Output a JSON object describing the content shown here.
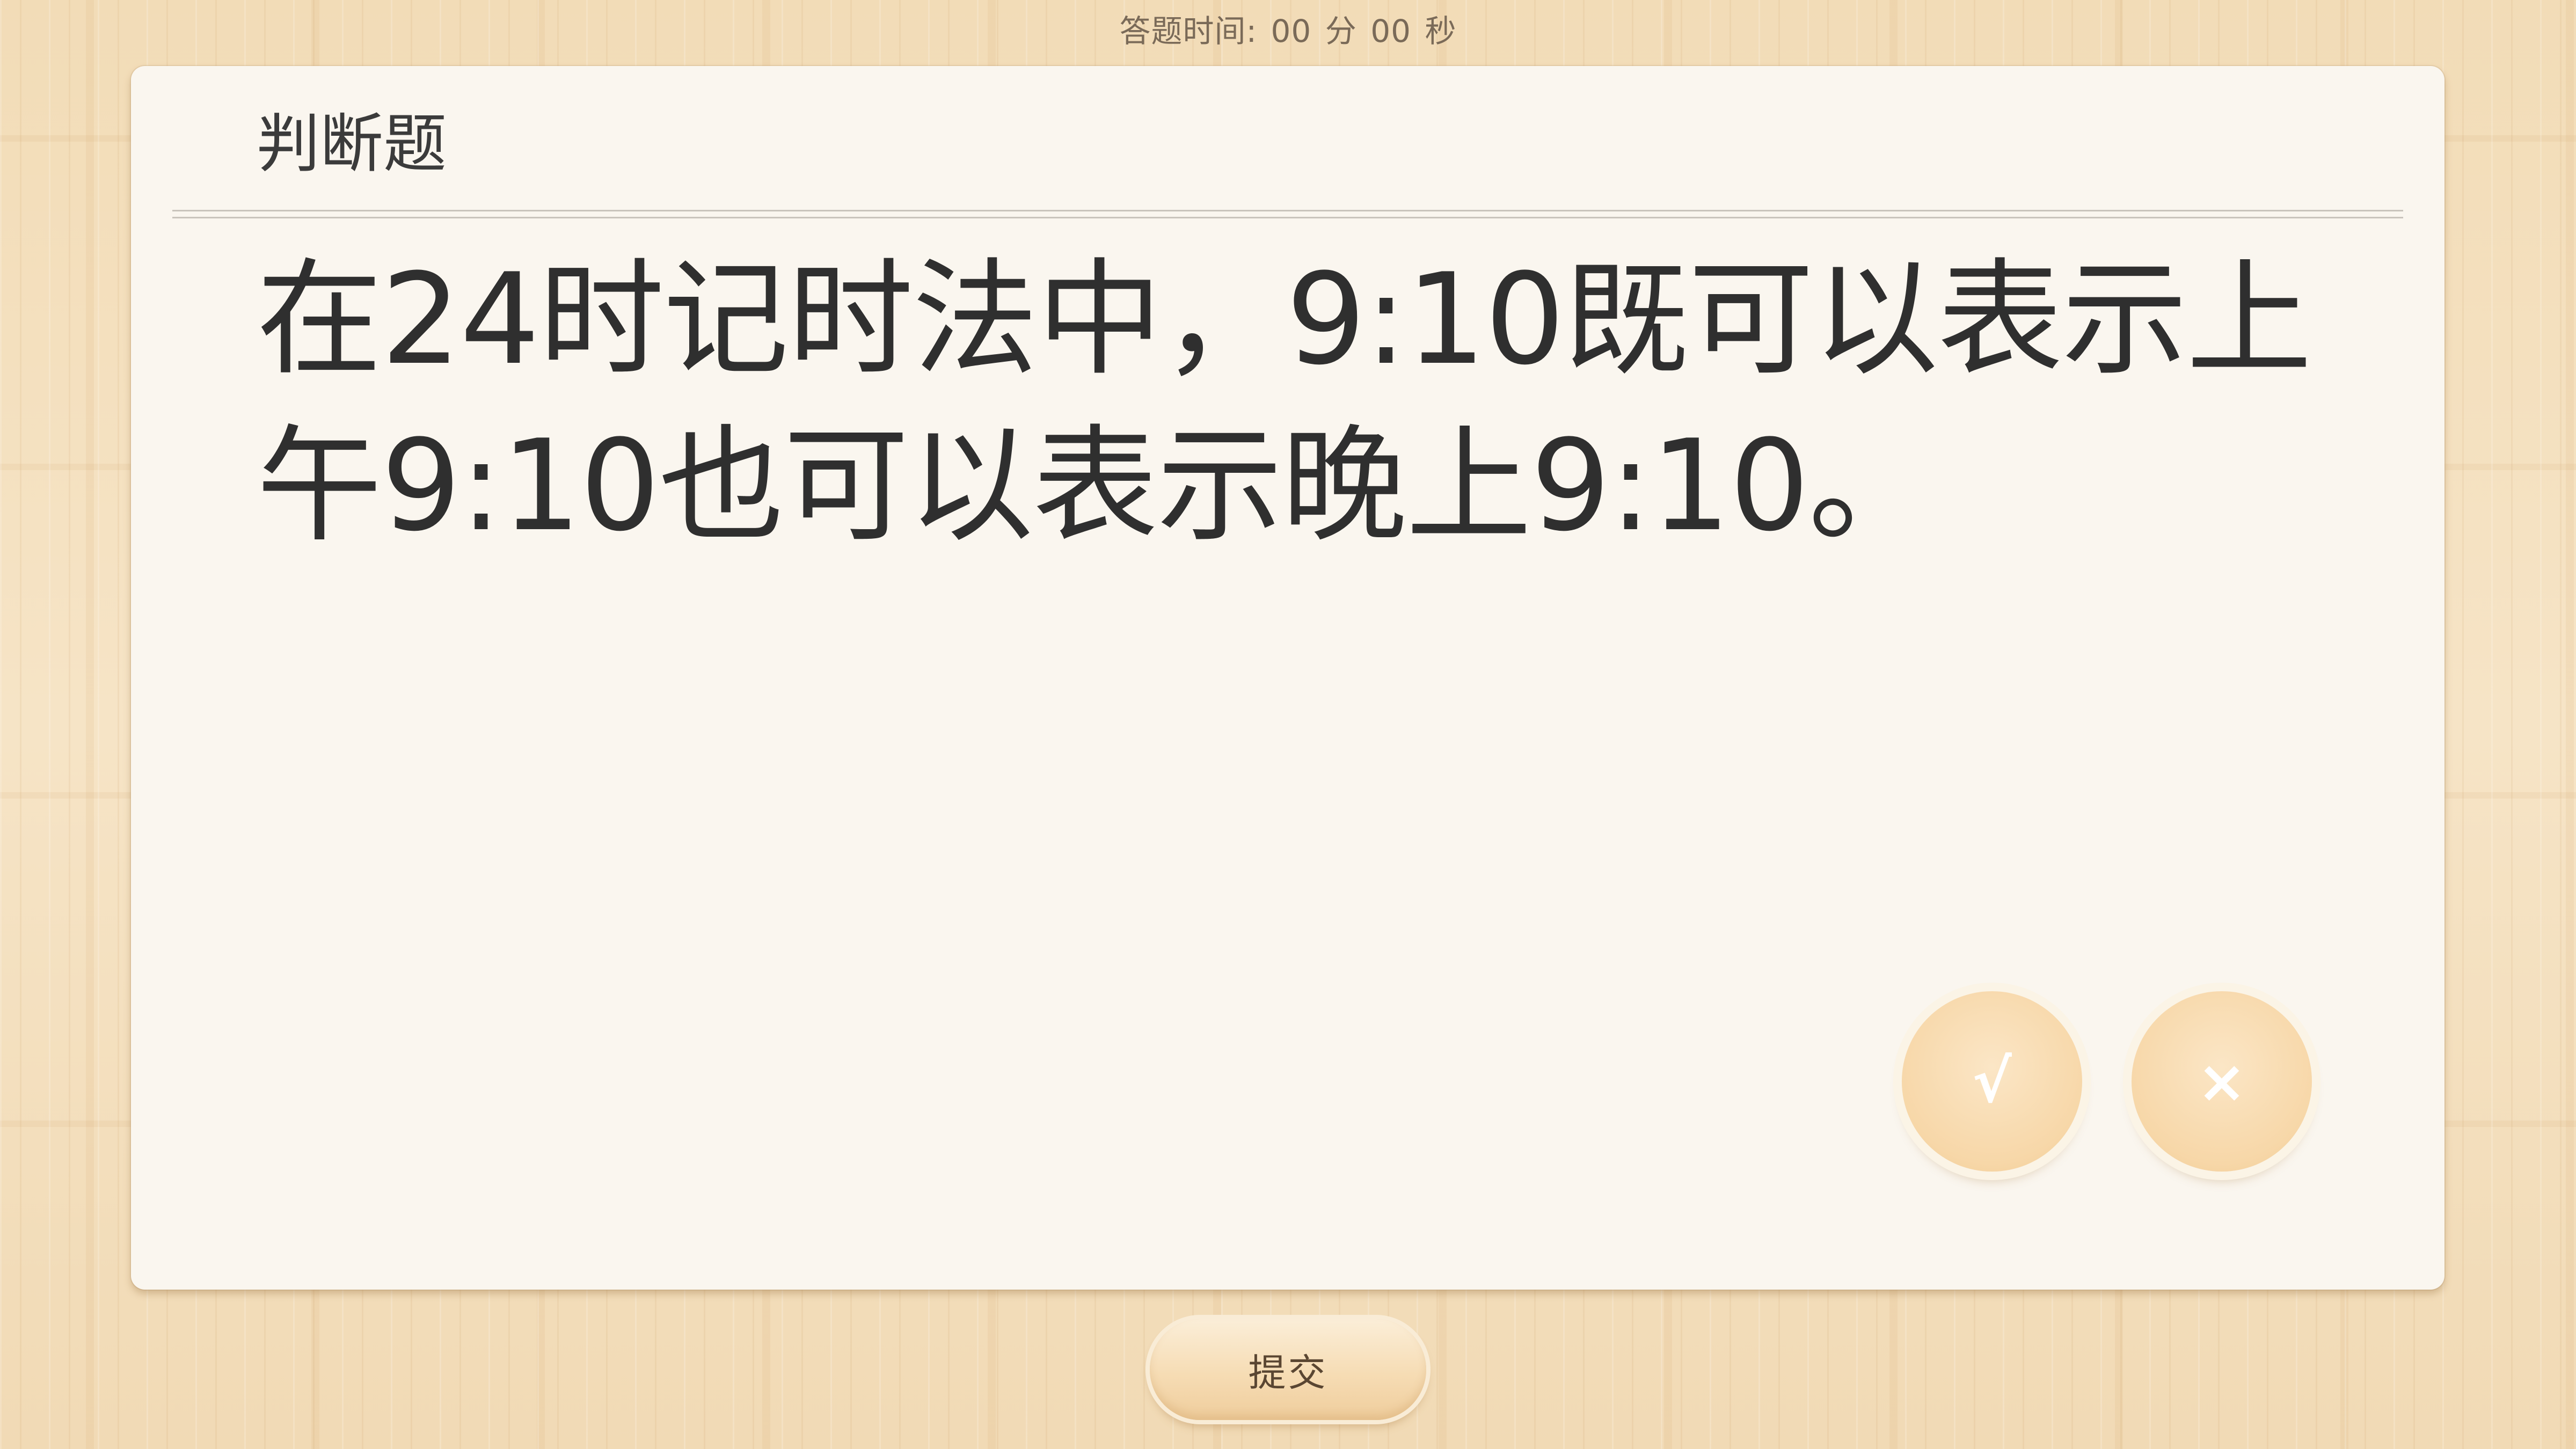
{
  "timer": {
    "label": "答题时间:",
    "minutes": "00",
    "minutes_unit": "分",
    "seconds": "00",
    "seconds_unit": "秒"
  },
  "card": {
    "header": "判断题",
    "question": "在24时记时法中，9:10既可以表示上午9:10也可以表示晚上9:10。"
  },
  "answers": {
    "true_label": "√",
    "false_label": "×"
  },
  "submit_label": "提交"
}
